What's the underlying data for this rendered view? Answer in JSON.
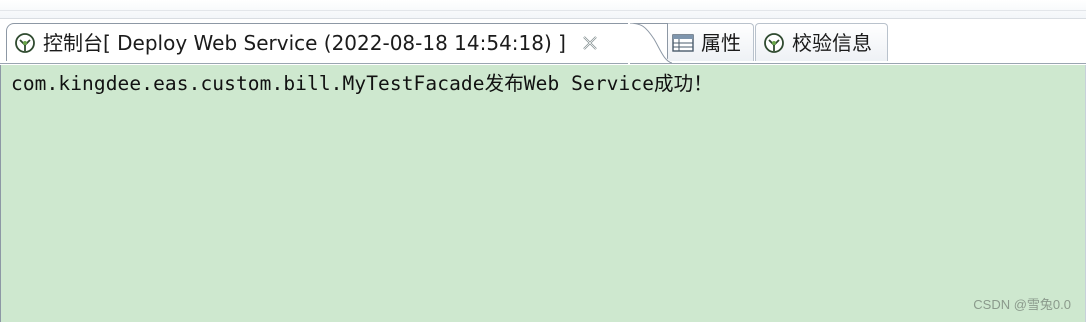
{
  "tabs": [
    {
      "id": "console",
      "icon": "console-icon",
      "label": "控制台[  Deploy Web Service (2022-08-18 14:54:18) ]",
      "close_icon": "close-icon",
      "active": true
    },
    {
      "id": "properties",
      "icon": "properties-table-icon",
      "label": "属性",
      "active": false
    },
    {
      "id": "validation",
      "icon": "validation-icon",
      "label": "校验信息",
      "active": false
    }
  ],
  "console": {
    "output": "com.kingdee.eas.custom.bill.MyTestFacade发布Web Service成功！"
  },
  "watermark": "CSDN @雪兔0.0",
  "colors": {
    "console_background": "#cee8cf",
    "tab_border": "#8d98a5",
    "text": "#1b1b1b"
  }
}
